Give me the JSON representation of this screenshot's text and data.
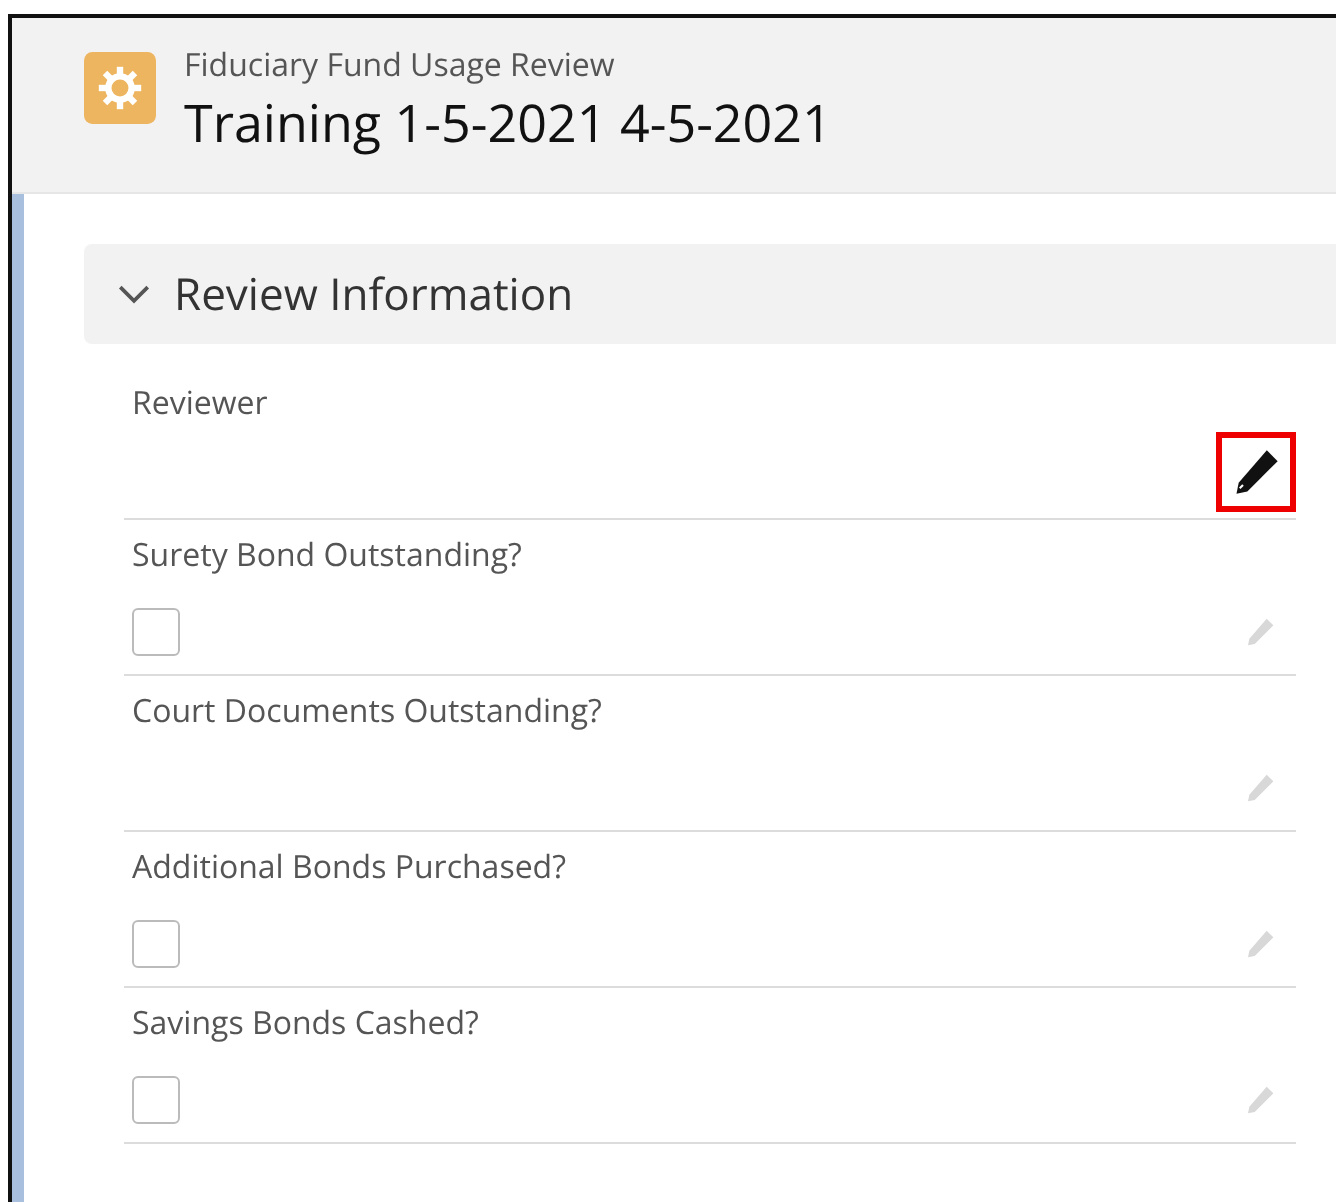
{
  "header": {
    "object_type": "Fiduciary Fund Usage Review",
    "title": "Training 1-5-2021 4-5-2021"
  },
  "section": {
    "title": "Review Information",
    "expanded": true,
    "fields": [
      {
        "label": "Reviewer",
        "kind": "text",
        "edit_highlighted": true
      },
      {
        "label": "Surety Bond Outstanding?",
        "kind": "checkbox",
        "checked": false,
        "edit_highlighted": false
      },
      {
        "label": "Court Documents Outstanding?",
        "kind": "text",
        "edit_highlighted": false
      },
      {
        "label": "Additional Bonds Purchased?",
        "kind": "checkbox",
        "checked": false,
        "edit_highlighted": false
      },
      {
        "label": "Savings Bonds Cashed?",
        "kind": "checkbox",
        "checked": false,
        "edit_highlighted": false
      }
    ]
  }
}
